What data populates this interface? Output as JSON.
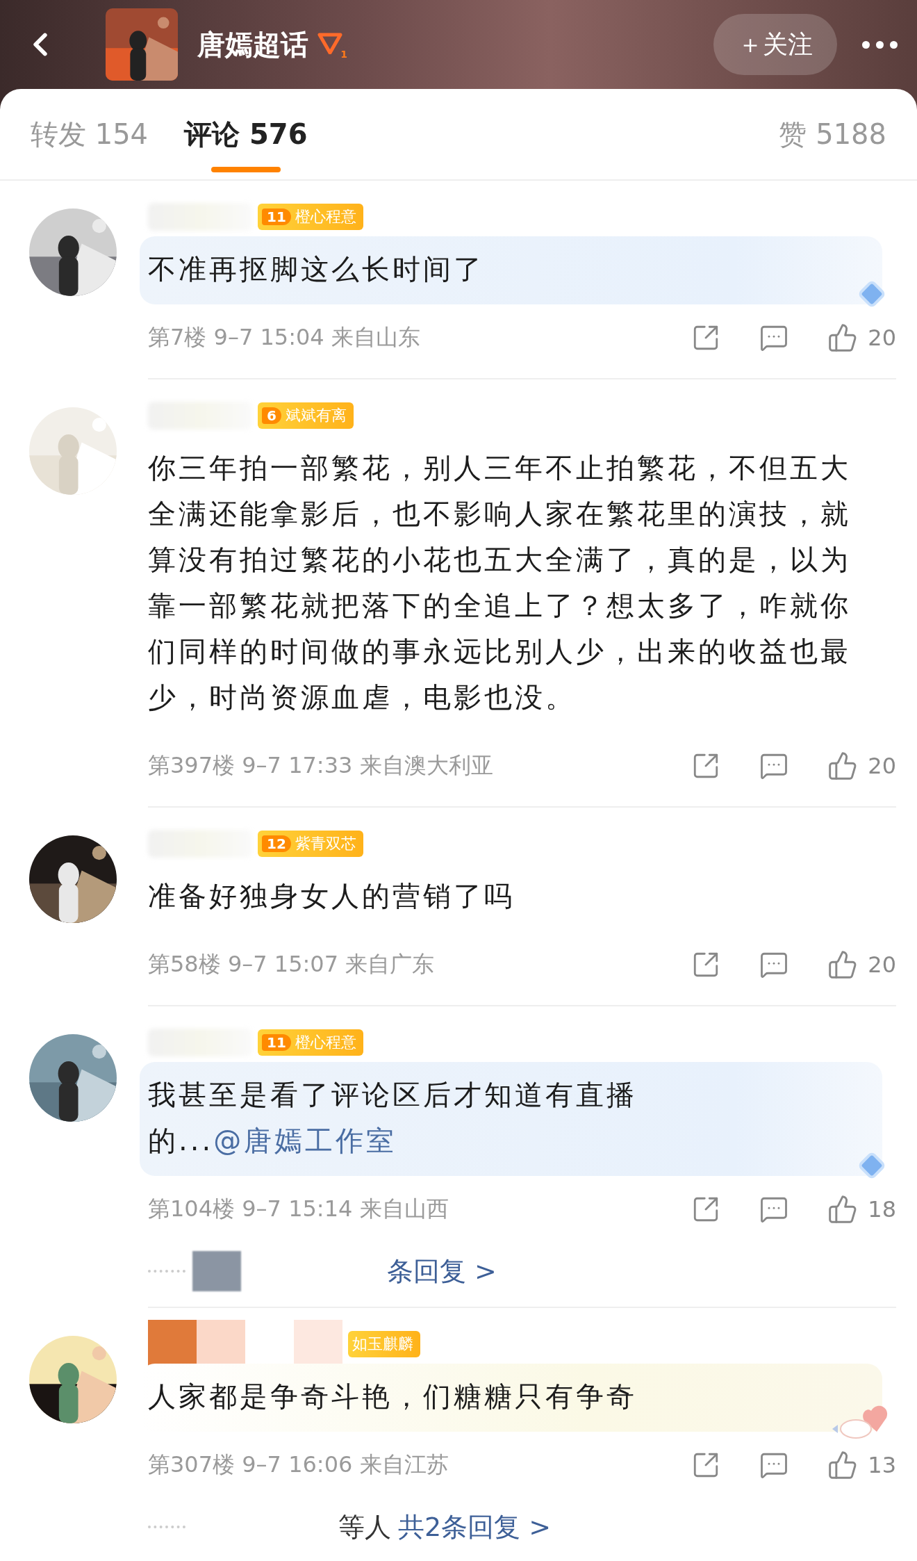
{
  "header": {
    "title": "唐嫣超话",
    "topic_level": "1",
    "follow": "＋关注"
  },
  "tabs": [
    {
      "label": "转发 154",
      "selected": false
    },
    {
      "label": "评论 576",
      "selected": true
    }
  ],
  "likes": "赞 5188",
  "comments": [
    {
      "kind": "diamond",
      "name_mosaic": false,
      "badge": {
        "level": "11",
        "name": "橙心程意"
      },
      "text": "不准再抠脚这么长时间了",
      "meta": "第7楼 9–7 15:04 来自山东",
      "likes": "20"
    },
    {
      "kind": "plain",
      "name_mosaic": false,
      "badge": {
        "level": "6",
        "name": "斌斌有离"
      },
      "text": "你三年拍一部繁花，别人三年不止拍繁花，不但五大全满还能拿影后，也不影响人家在繁花里的演技，就算没有拍过繁花的小花也五大全满了，真的是，以为靠一部繁花就把落下的全追上了？想太多了，咋就你们同样的时间做的事永远比别人少，出来的收益也最少，时尚资源血虐，电影也没。",
      "meta": "第397楼 9–7 17:33 来自澳大利亚",
      "likes": "20"
    },
    {
      "kind": "plain",
      "name_mosaic": false,
      "badge": {
        "level": "12",
        "name": "紫青双芯"
      },
      "text": "准备好独身女人的营销了吗",
      "meta": "第58楼 9–7 15:07 来自广东",
      "likes": "20"
    },
    {
      "kind": "diamond",
      "name_mosaic": false,
      "badge": {
        "level": "11",
        "name": "橙心程意"
      },
      "text": "我甚至是看了评论区后才知道有直播的...",
      "mention": "@唐嫣工作室",
      "meta": "第104楼 9–7 15:14 来自山西",
      "likes": "18",
      "replies": {
        "link": "条回复 >"
      }
    },
    {
      "kind": "bunny",
      "name_mosaic": true,
      "badge": {
        "name": "如玉麒麟"
      },
      "text": "人家都是争奇斗艳，们糖糖只有争奇",
      "meta": "第307楼 9–7 16:06 来自江苏",
      "likes": "13",
      "replies": {
        "prefix": "等人",
        "link": "共2条回复 >"
      }
    }
  ]
}
